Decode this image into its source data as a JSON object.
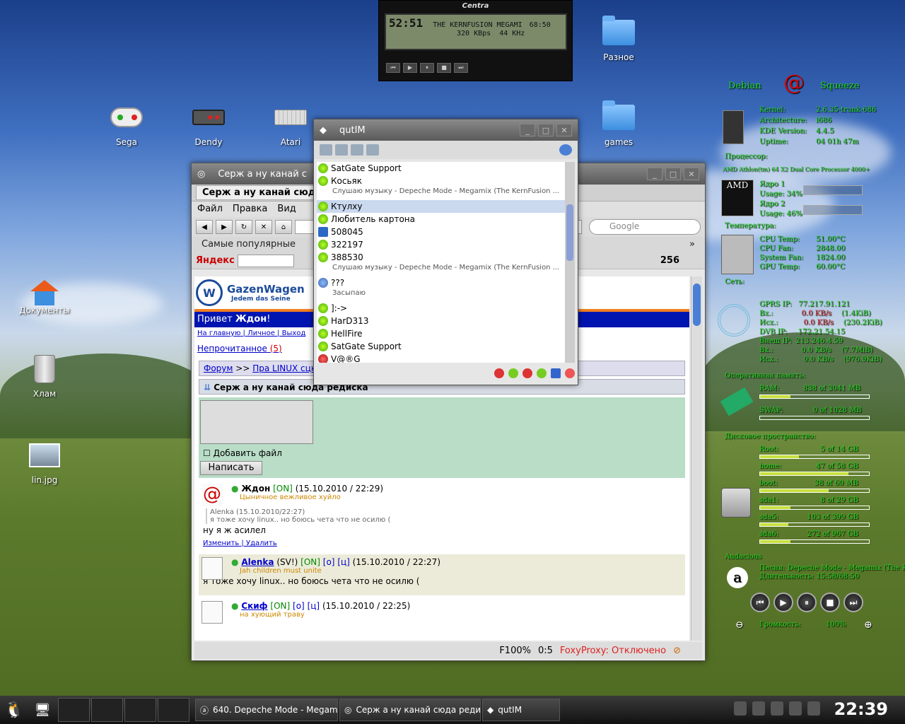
{
  "desktop": {
    "icons": [
      {
        "label": "Sega",
        "icon": "gamepad-icon"
      },
      {
        "label": "Dendy",
        "icon": "nes-controller-icon"
      },
      {
        "label": "Atari",
        "icon": "keyboard-icon"
      },
      {
        "label": "Документы",
        "icon": "home-folder-icon"
      },
      {
        "label": "Хлам",
        "icon": "trash-icon"
      },
      {
        "label": "lin.jpg",
        "icon": "image-file-icon"
      },
      {
        "label": "Разное",
        "icon": "folder-icon"
      },
      {
        "label": "games",
        "icon": "folder-icon"
      }
    ]
  },
  "player": {
    "brand": "Centra",
    "time": "52:51",
    "track": "THE KERNFUSION MEGAMI",
    "length": "68:50",
    "bitrate": "320 KBps",
    "samplerate": "44 KHz"
  },
  "browser": {
    "title": "Серж а ну канай с",
    "tab": "Серж а ну канай сюда редиска",
    "menu": [
      "Файл",
      "Правка",
      "Вид"
    ],
    "search_placeholder": "Google",
    "bookmarks_label": "Самые популярные",
    "yandex": "Яндекс",
    "yandex_num": "256",
    "site": {
      "logo_title": "GazenWagen",
      "logo_sub": "Jedem das Seine",
      "hello": "Привет",
      "user": "Ждон",
      "links": [
        "На главную",
        "Личное",
        "Выход"
      ],
      "unread": "Непрочитанное",
      "unread_count": "(5)",
      "crumb_forum": "Форум",
      "crumb_sep": ">>",
      "crumb_section": "Пра LINUX сцко",
      "thread_title": "Серж а ну канай сюда редиска",
      "add_file": "Добавить файл",
      "send_btn": "Написать"
    },
    "posts": [
      {
        "author": "Ждон",
        "online": "[ON]",
        "date": "(15.10.2010 / 22:29)",
        "status": "Цыничное вежливое хуйло",
        "quote": "Alenka (15.10.2010/22:27)",
        "quote_text": "я тоже хочу linux.. но боюсь чета что не осилю (",
        "text": "ну я ж асилел",
        "edit": "Изменить",
        "delete": "Удалить"
      },
      {
        "author": "Alenka",
        "extra": "(SV!)",
        "online": "[ON]",
        "o": "[o]",
        "c": "[ц]",
        "date": "(15.10.2010 / 22:27)",
        "status": "Jah children must unite",
        "text": "я тоже хочу linux.. но боюсь чета что не осилю ("
      },
      {
        "author": "Скиф",
        "online": "[ON]",
        "o": "[o]",
        "c": "[ц]",
        "date": "(15.10.2010 / 22:25)",
        "status": "на хующий траву"
      }
    ],
    "status": {
      "zoom": "F100%",
      "counter": "0:5",
      "foxy": "FoxyProxy: Отключено"
    }
  },
  "qutim": {
    "title": "qutIM",
    "contacts": [
      {
        "name": "SatGate Support",
        "type": "jabber"
      },
      {
        "name": "Косьяк",
        "type": "jabber",
        "msg": "Слушаю музыку - Depeche Mode - Megamix (The KernFusion ..."
      },
      {
        "name": "Ктулху",
        "type": "jabber",
        "selected": true
      },
      {
        "name": "Любитель картона",
        "type": "jabber"
      },
      {
        "name": "508045",
        "type": "icq"
      },
      {
        "name": "322197",
        "type": "jabber"
      },
      {
        "name": "388530",
        "type": "jabber",
        "msg": "Слушаю музыку - Depeche Mode - Megamix (The KernFusion ..."
      },
      {
        "name": "???",
        "type": "away",
        "msg": "Засыпаю"
      },
      {
        "name": "]:->",
        "type": "jabber"
      },
      {
        "name": "HarD313",
        "type": "jabber"
      },
      {
        "name": "HellFire",
        "type": "jabber"
      },
      {
        "name": "SatGate Support",
        "type": "jabber"
      },
      {
        "name": "V@®G",
        "type": "dnd"
      }
    ]
  },
  "conky": {
    "distro": "Debian",
    "release": "Squeeze",
    "kernel_label": "Kernel:",
    "kernel": "2.6.35-trunk-686",
    "arch_label": "Architecture:",
    "arch": "i686",
    "kde_label": "KDE Version:",
    "kde": "4.4.5",
    "uptime_label": "Uptime:",
    "uptime": "04 01h 47m",
    "cpu_head": "Процессор:",
    "cpu_name": "AMD Athlon(tm) 64 X2 Dual Core Processor 4000+",
    "core1": "Ядро 1",
    "usage1": "Usage: 34%",
    "core2": "Ядро 2",
    "usage2": "Usage: 46%",
    "temp_head": "Температура:",
    "cpu_temp_label": "CPU Temp:",
    "cpu_temp": "51.00°C",
    "cpu_fan_label": "CPU Fan:",
    "cpu_fan": "2848.00",
    "sys_fan_label": "System Fan:",
    "sys_fan": "1824.00",
    "gpu_temp_label": "GPU Temp:",
    "gpu_temp": "60.00°C",
    "net_head": "Сеть:",
    "gprs_label": "GPRS IP:",
    "gprs_ip": "77.217.91.121",
    "in_label": "Вх.:",
    "in1_rate": "0.0 KB/s",
    "in1_total": "(1.4KiB)",
    "out_label": "Исх.:",
    "out1_rate": "0.0 KB/s",
    "out1_total": "(230.2KiB)",
    "dvb_label": "DVB IP:",
    "dvb_ip": "172.21.54.15",
    "ext_label": "Внеш IP:",
    "ext_ip": "213.246.4.59",
    "in2_rate": "0.0 KB/s",
    "in2_total": "(7.7MiB)",
    "out2_rate": "0.0 KB/s",
    "out2_total": "(976.9KiB)",
    "ram_head": "Оперативная память:",
    "ram_label": "RAM:",
    "ram": "838 of 3041 MB",
    "ram_frac": 0.28,
    "swap_label": "SWAP:",
    "swap": "0 of 1028 MB",
    "swap_frac": 0.0,
    "disk_head": "Дисковое пространство:",
    "disks": [
      {
        "label": "Root:",
        "value": "5 of 14 GB",
        "frac": 0.36
      },
      {
        "label": "home:",
        "value": "47 of 58 GB",
        "frac": 0.81
      },
      {
        "label": "boot:",
        "value": "38 of 60 MB",
        "frac": 0.63
      },
      {
        "label": "sda1:",
        "value": "8 of 29 GB",
        "frac": 0.28
      },
      {
        "label": "sda5:",
        "value": "103 of 399 GB",
        "frac": 0.26
      },
      {
        "label": "sda6:",
        "value": "272 of 967 GB",
        "frac": 0.28
      }
    ],
    "audacious_head": "Audacious",
    "song_label": "Песня:",
    "song": "Depeche Mode - Megamix (The K",
    "duration_label": "Длительность:",
    "duration": "15:58/68:50",
    "volume_label": "Громкость:",
    "volume": "100%"
  },
  "taskbar": {
    "tasks": [
      "640. Depeche Mode - Megam",
      "Серж а ну канай сюда реди",
      "qutIM"
    ],
    "clock": "22:39"
  }
}
